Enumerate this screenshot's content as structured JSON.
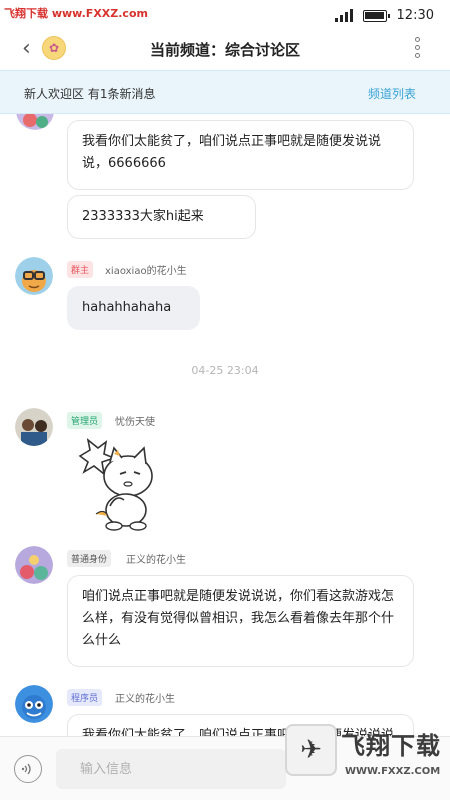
{
  "status_bar": {
    "watermark_left": "飞翔下载",
    "watermark_url": "www.FXXZ.com",
    "time": "12:30",
    "signal_icon": "signal-bars-icon",
    "battery_icon": "battery-icon"
  },
  "header": {
    "title": "当前频道：综合讨论区",
    "back_icon": "chevron-left-icon",
    "more_icon": "vertical-dots-icon"
  },
  "banner": {
    "left_text": "新人欢迎区 有1条新消息",
    "right_link": "频道列表"
  },
  "messages": {
    "m1": {
      "text": "我看你们太能贫了，咱们说点正事吧就是随便发说说说，6666666"
    },
    "m2": {
      "text": "2333333大家hi起来"
    },
    "m3": {
      "role": "群主",
      "name": "xiaoxiao的花小生",
      "text": "hahahhahaha"
    },
    "timestamp": "04-25 23:04",
    "m4": {
      "role": "管理员",
      "name": "忧伤天使",
      "content_type": "sticker"
    },
    "m5": {
      "role": "普通身份",
      "name": "正义的花小生",
      "text": "咱们说点正事吧就是随便发说说说，你们看这款游戏怎么样，有没有觉得似曾相识，我怎么看着像去年那个什么什么"
    },
    "m6": {
      "role": "程序员",
      "name": "正义的花小生",
      "text": "我看你们太能贫了，咱们说点正事吧就是随便发说说说"
    }
  },
  "footer": {
    "input_placeholder": "输入信息",
    "voice_icon": "voice-icon"
  },
  "watermark_bottom": {
    "brand": "飞翔下载",
    "url": "WWW.FXXZ.COM"
  },
  "colors": {
    "banner_bg": "#e9f5fb",
    "link_blue": "#3aa3d6",
    "tag_owner": "#e9525b",
    "tag_admin": "#22a56e",
    "tag_normal": "#555555",
    "tag_programmer": "#5e6fd4"
  }
}
